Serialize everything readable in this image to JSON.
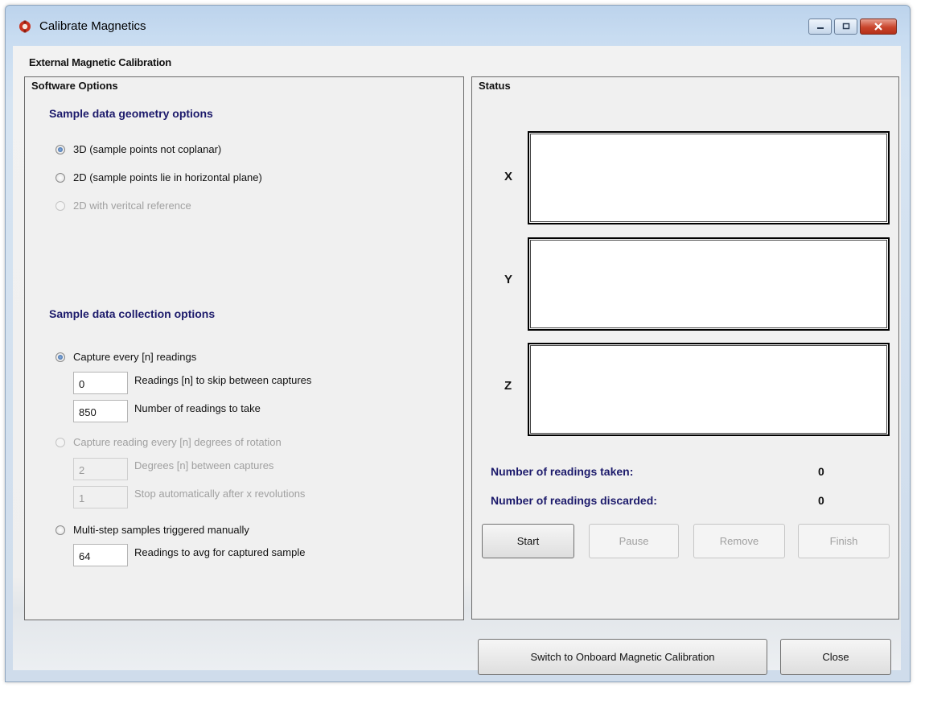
{
  "window": {
    "title": "Calibrate Magnetics",
    "minimize_icon": "minimize-icon",
    "maximize_icon": "maximize-icon",
    "close_icon": "close-icon"
  },
  "heading": "External Magnetic Calibration",
  "software_options": {
    "group_label": "Software Options",
    "geometry": {
      "title": "Sample data geometry options",
      "options": [
        {
          "label": "3D  (sample points not coplanar)",
          "checked": true,
          "enabled": true
        },
        {
          "label": "2D  (sample points lie in horizontal plane)",
          "checked": false,
          "enabled": true
        },
        {
          "label": "2D with veritcal reference",
          "checked": false,
          "enabled": false
        }
      ]
    },
    "collection": {
      "title": "Sample data collection options",
      "capture_every": {
        "label": "Capture every [n] readings",
        "checked": true,
        "skip_value": "0",
        "skip_label": "Readings [n] to skip between captures",
        "count_value": "850",
        "count_label": "Number of readings to take"
      },
      "capture_rotation": {
        "label": "Capture reading every [n] degrees of rotation",
        "checked": false,
        "enabled": false,
        "degrees_value": "2",
        "degrees_label": "Degrees [n] between captures",
        "revs_value": "1",
        "revs_label": "Stop automatically after x revolutions"
      },
      "multi_step": {
        "label": "Multi-step samples triggered manually",
        "checked": false,
        "avg_value": "64",
        "avg_label": "Readings to avg for captured sample"
      }
    }
  },
  "status": {
    "group_label": "Status",
    "axes": [
      "X",
      "Y",
      "Z"
    ],
    "readings_taken_label": "Number of readings taken:",
    "readings_taken_value": "0",
    "readings_discarded_label": "Number of readings discarded:",
    "readings_discarded_value": "0",
    "buttons": {
      "start": "Start",
      "pause": "Pause",
      "remove": "Remove",
      "finish": "Finish"
    }
  },
  "footer": {
    "switch_label": "Switch to Onboard Magnetic Calibration",
    "close_label": "Close"
  }
}
